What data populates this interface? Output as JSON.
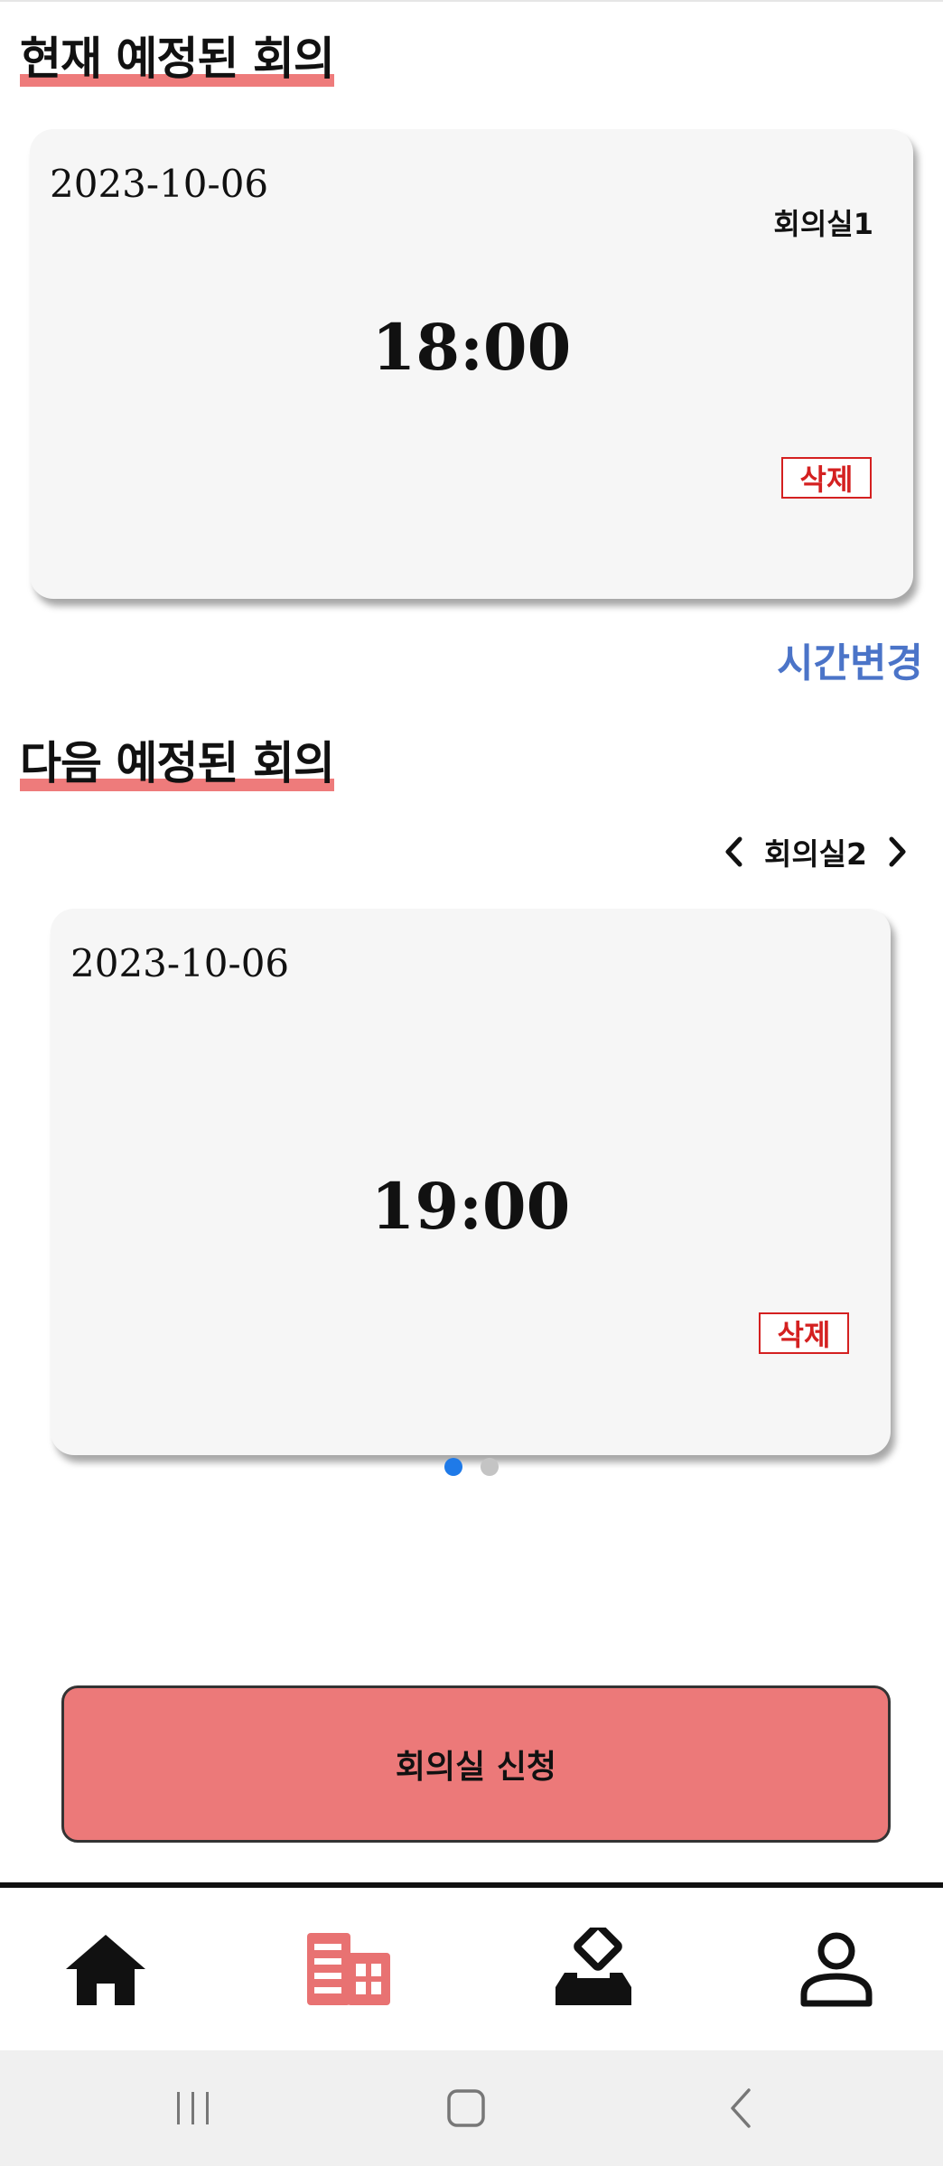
{
  "current": {
    "title": "현재 예정된 회의",
    "date": "2023-10-06",
    "room": "회의실1",
    "time": "18:00",
    "delete_label": "삭제",
    "time_change_label": "시간변경"
  },
  "next": {
    "title": "다음 예정된 회의",
    "room_selector": "회의실2",
    "date": "2023-10-06",
    "time": "19:00",
    "delete_label": "삭제",
    "pagination": {
      "total": 2,
      "active": 1
    }
  },
  "apply_button_label": "회의실 신청",
  "bottom_nav": {
    "items": [
      {
        "icon": "home-icon",
        "active": false
      },
      {
        "icon": "building-icon",
        "active": true
      },
      {
        "icon": "vote-icon",
        "active": false
      },
      {
        "icon": "profile-icon",
        "active": false
      }
    ],
    "active_color": "#e87272"
  },
  "colors": {
    "accent": "#ec7979",
    "highlight": "#ee7b7b",
    "delete": "#d42020",
    "link": "#4b74c8",
    "dot_active": "#1f7ae8"
  }
}
